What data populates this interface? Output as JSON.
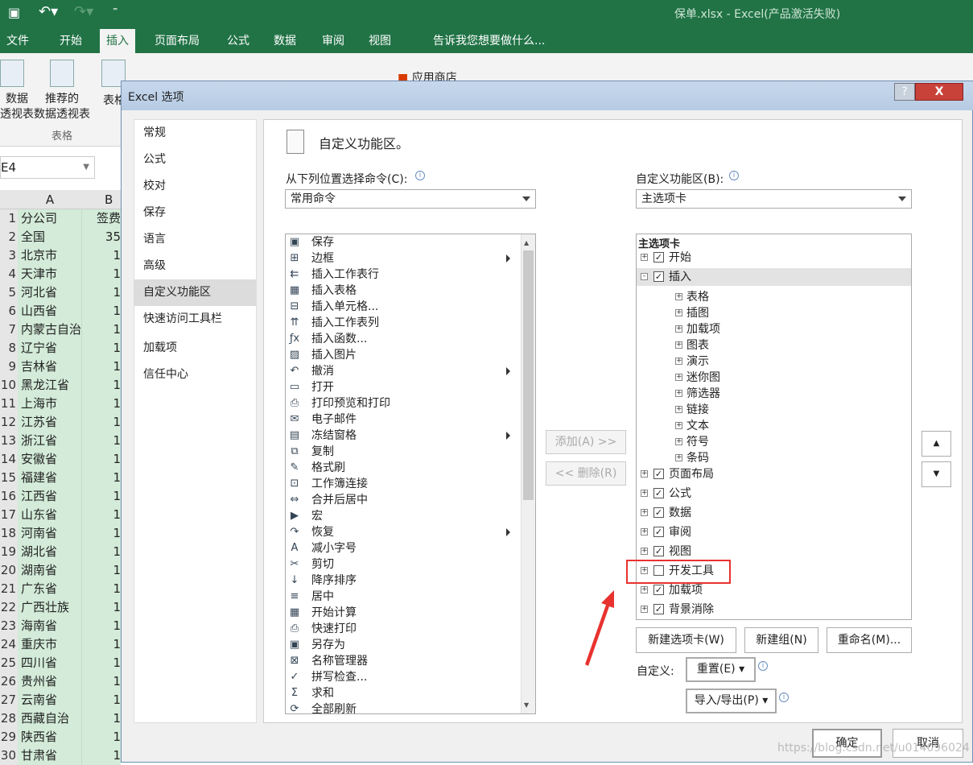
{
  "window": {
    "title": "保单.xlsx - Excel(产品激活失败)"
  },
  "ribbon": {
    "tabs": [
      "文件",
      "开始",
      "插入",
      "页面布局",
      "公式",
      "数据",
      "审阅",
      "视图"
    ],
    "active_tab": "插入",
    "tell_me": "告诉我您想要做什么...",
    "buttons": [
      "数据\n透视表",
      "推荐的\n数据透视表",
      "表格"
    ],
    "group_label": "表格",
    "store": "应用商店"
  },
  "sheet": {
    "name_box": "E4",
    "col_a": "A",
    "col_b": "B",
    "rows": [
      {
        "n": "1",
        "a": "分公司",
        "b": "签费"
      },
      {
        "n": "2",
        "a": "全国",
        "b": "35"
      },
      {
        "n": "3",
        "a": "北京市",
        "b": "1"
      },
      {
        "n": "4",
        "a": "天津市",
        "b": "1"
      },
      {
        "n": "5",
        "a": "河北省",
        "b": "1"
      },
      {
        "n": "6",
        "a": "山西省",
        "b": "1"
      },
      {
        "n": "7",
        "a": "内蒙古自治",
        "b": "1"
      },
      {
        "n": "8",
        "a": "辽宁省",
        "b": "1"
      },
      {
        "n": "9",
        "a": "吉林省",
        "b": "1"
      },
      {
        "n": "10",
        "a": "黑龙江省",
        "b": "1"
      },
      {
        "n": "11",
        "a": "上海市",
        "b": "1"
      },
      {
        "n": "12",
        "a": "江苏省",
        "b": "1"
      },
      {
        "n": "13",
        "a": "浙江省",
        "b": "1"
      },
      {
        "n": "14",
        "a": "安徽省",
        "b": "1"
      },
      {
        "n": "15",
        "a": "福建省",
        "b": "1"
      },
      {
        "n": "16",
        "a": "江西省",
        "b": "1"
      },
      {
        "n": "17",
        "a": "山东省",
        "b": "1"
      },
      {
        "n": "18",
        "a": "河南省",
        "b": "1"
      },
      {
        "n": "19",
        "a": "湖北省",
        "b": "1"
      },
      {
        "n": "20",
        "a": "湖南省",
        "b": "1"
      },
      {
        "n": "21",
        "a": "广东省",
        "b": "1"
      },
      {
        "n": "22",
        "a": "广西壮族",
        "b": "1"
      },
      {
        "n": "23",
        "a": "海南省",
        "b": "1"
      },
      {
        "n": "24",
        "a": "重庆市",
        "b": "1"
      },
      {
        "n": "25",
        "a": "四川省",
        "b": "1"
      },
      {
        "n": "26",
        "a": "贵州省",
        "b": "1"
      },
      {
        "n": "27",
        "a": "云南省",
        "b": "1"
      },
      {
        "n": "28",
        "a": "西藏自治",
        "b": "1"
      },
      {
        "n": "29",
        "a": "陕西省",
        "b": "1"
      },
      {
        "n": "30",
        "a": "甘肃省",
        "b": "1"
      }
    ]
  },
  "dialog": {
    "title": "Excel 选项",
    "help": "?",
    "close": "X",
    "nav": [
      "常规",
      "公式",
      "校对",
      "保存",
      "语言",
      "高级",
      "自定义功能区",
      "快速访问工具栏",
      "加载项",
      "信任中心"
    ],
    "nav_selected": "自定义功能区",
    "heading": "自定义功能区。",
    "left_label": "从下列位置选择命令(C):",
    "left_select": "常用命令",
    "commands": [
      {
        "icon": "save",
        "label": "保存"
      },
      {
        "icon": "border",
        "label": "边框",
        "sub": true
      },
      {
        "icon": "insert-row",
        "label": "插入工作表行"
      },
      {
        "icon": "table",
        "label": "插入表格"
      },
      {
        "icon": "insert-cell",
        "label": "插入单元格..."
      },
      {
        "icon": "insert-col",
        "label": "插入工作表列"
      },
      {
        "icon": "fx",
        "label": "插入函数..."
      },
      {
        "icon": "picture",
        "label": "插入图片"
      },
      {
        "icon": "undo",
        "label": "撤消",
        "sub": true
      },
      {
        "icon": "folder",
        "label": "打开"
      },
      {
        "icon": "print-preview",
        "label": "打印预览和打印"
      },
      {
        "icon": "mail",
        "label": "电子邮件"
      },
      {
        "icon": "freeze",
        "label": "冻结窗格",
        "sub": true
      },
      {
        "icon": "copy",
        "label": "复制"
      },
      {
        "icon": "brush",
        "label": "格式刷"
      },
      {
        "icon": "link",
        "label": "工作簿连接"
      },
      {
        "icon": "merge",
        "label": "合并后居中"
      },
      {
        "icon": "macro",
        "label": "宏"
      },
      {
        "icon": "redo",
        "label": "恢复",
        "sub": true
      },
      {
        "icon": "font-smaller",
        "label": "减小字号"
      },
      {
        "icon": "scissors",
        "label": "剪切"
      },
      {
        "icon": "sort-desc",
        "label": "降序排序"
      },
      {
        "icon": "center",
        "label": "居中"
      },
      {
        "icon": "calculator",
        "label": "开始计算"
      },
      {
        "icon": "quick-print",
        "label": "快速打印"
      },
      {
        "icon": "save-as",
        "label": "另存为"
      },
      {
        "icon": "name-manager",
        "label": "名称管理器"
      },
      {
        "icon": "spell-check",
        "label": "拼写检查..."
      },
      {
        "icon": "sum",
        "label": "求和"
      },
      {
        "icon": "refresh",
        "label": "全部刷新"
      }
    ],
    "add_button": "添加(A) >>",
    "remove_button": "<< 删除(R)",
    "right_label": "自定义功能区(B):",
    "right_select": "主选项卡",
    "tree_header": "主选项卡",
    "tree": [
      {
        "label": "开始",
        "level": 0,
        "checked": true,
        "expand": "+"
      },
      {
        "label": "插入",
        "level": 0,
        "checked": true,
        "expand": "-",
        "selected": true
      },
      {
        "label": "表格",
        "level": 1
      },
      {
        "label": "插图",
        "level": 1
      },
      {
        "label": "加载项",
        "level": 1
      },
      {
        "label": "图表",
        "level": 1
      },
      {
        "label": "演示",
        "level": 1
      },
      {
        "label": "迷你图",
        "level": 1
      },
      {
        "label": "筛选器",
        "level": 1
      },
      {
        "label": "链接",
        "level": 1
      },
      {
        "label": "文本",
        "level": 1
      },
      {
        "label": "符号",
        "level": 1
      },
      {
        "label": "条码",
        "level": 1
      },
      {
        "label": "页面布局",
        "level": 0,
        "checked": true,
        "expand": "+"
      },
      {
        "label": "公式",
        "level": 0,
        "checked": true,
        "expand": "+"
      },
      {
        "label": "数据",
        "level": 0,
        "checked": true,
        "expand": "+"
      },
      {
        "label": "审阅",
        "level": 0,
        "checked": true,
        "expand": "+"
      },
      {
        "label": "视图",
        "level": 0,
        "checked": true,
        "expand": "+"
      },
      {
        "label": "开发工具",
        "level": 0,
        "checked": false,
        "expand": "+",
        "highlighted": true
      },
      {
        "label": "加载项",
        "level": 0,
        "checked": true,
        "expand": "+"
      },
      {
        "label": "背景消除",
        "level": 0,
        "checked": true,
        "expand": "+"
      }
    ],
    "new_tab": "新建选项卡(W)",
    "new_group": "新建组(N)",
    "rename": "重命名(M)...",
    "customize_label": "自定义:",
    "reset": "重置(E)",
    "import_export": "导入/导出(P)",
    "ok": "确定",
    "cancel": "取消"
  },
  "watermark": "https://blog.csdn.net/u014096024",
  "colors": {
    "excel_green": "#217346",
    "highlight_red": "#e8322f",
    "selection_fill": "#d3ebd8"
  }
}
